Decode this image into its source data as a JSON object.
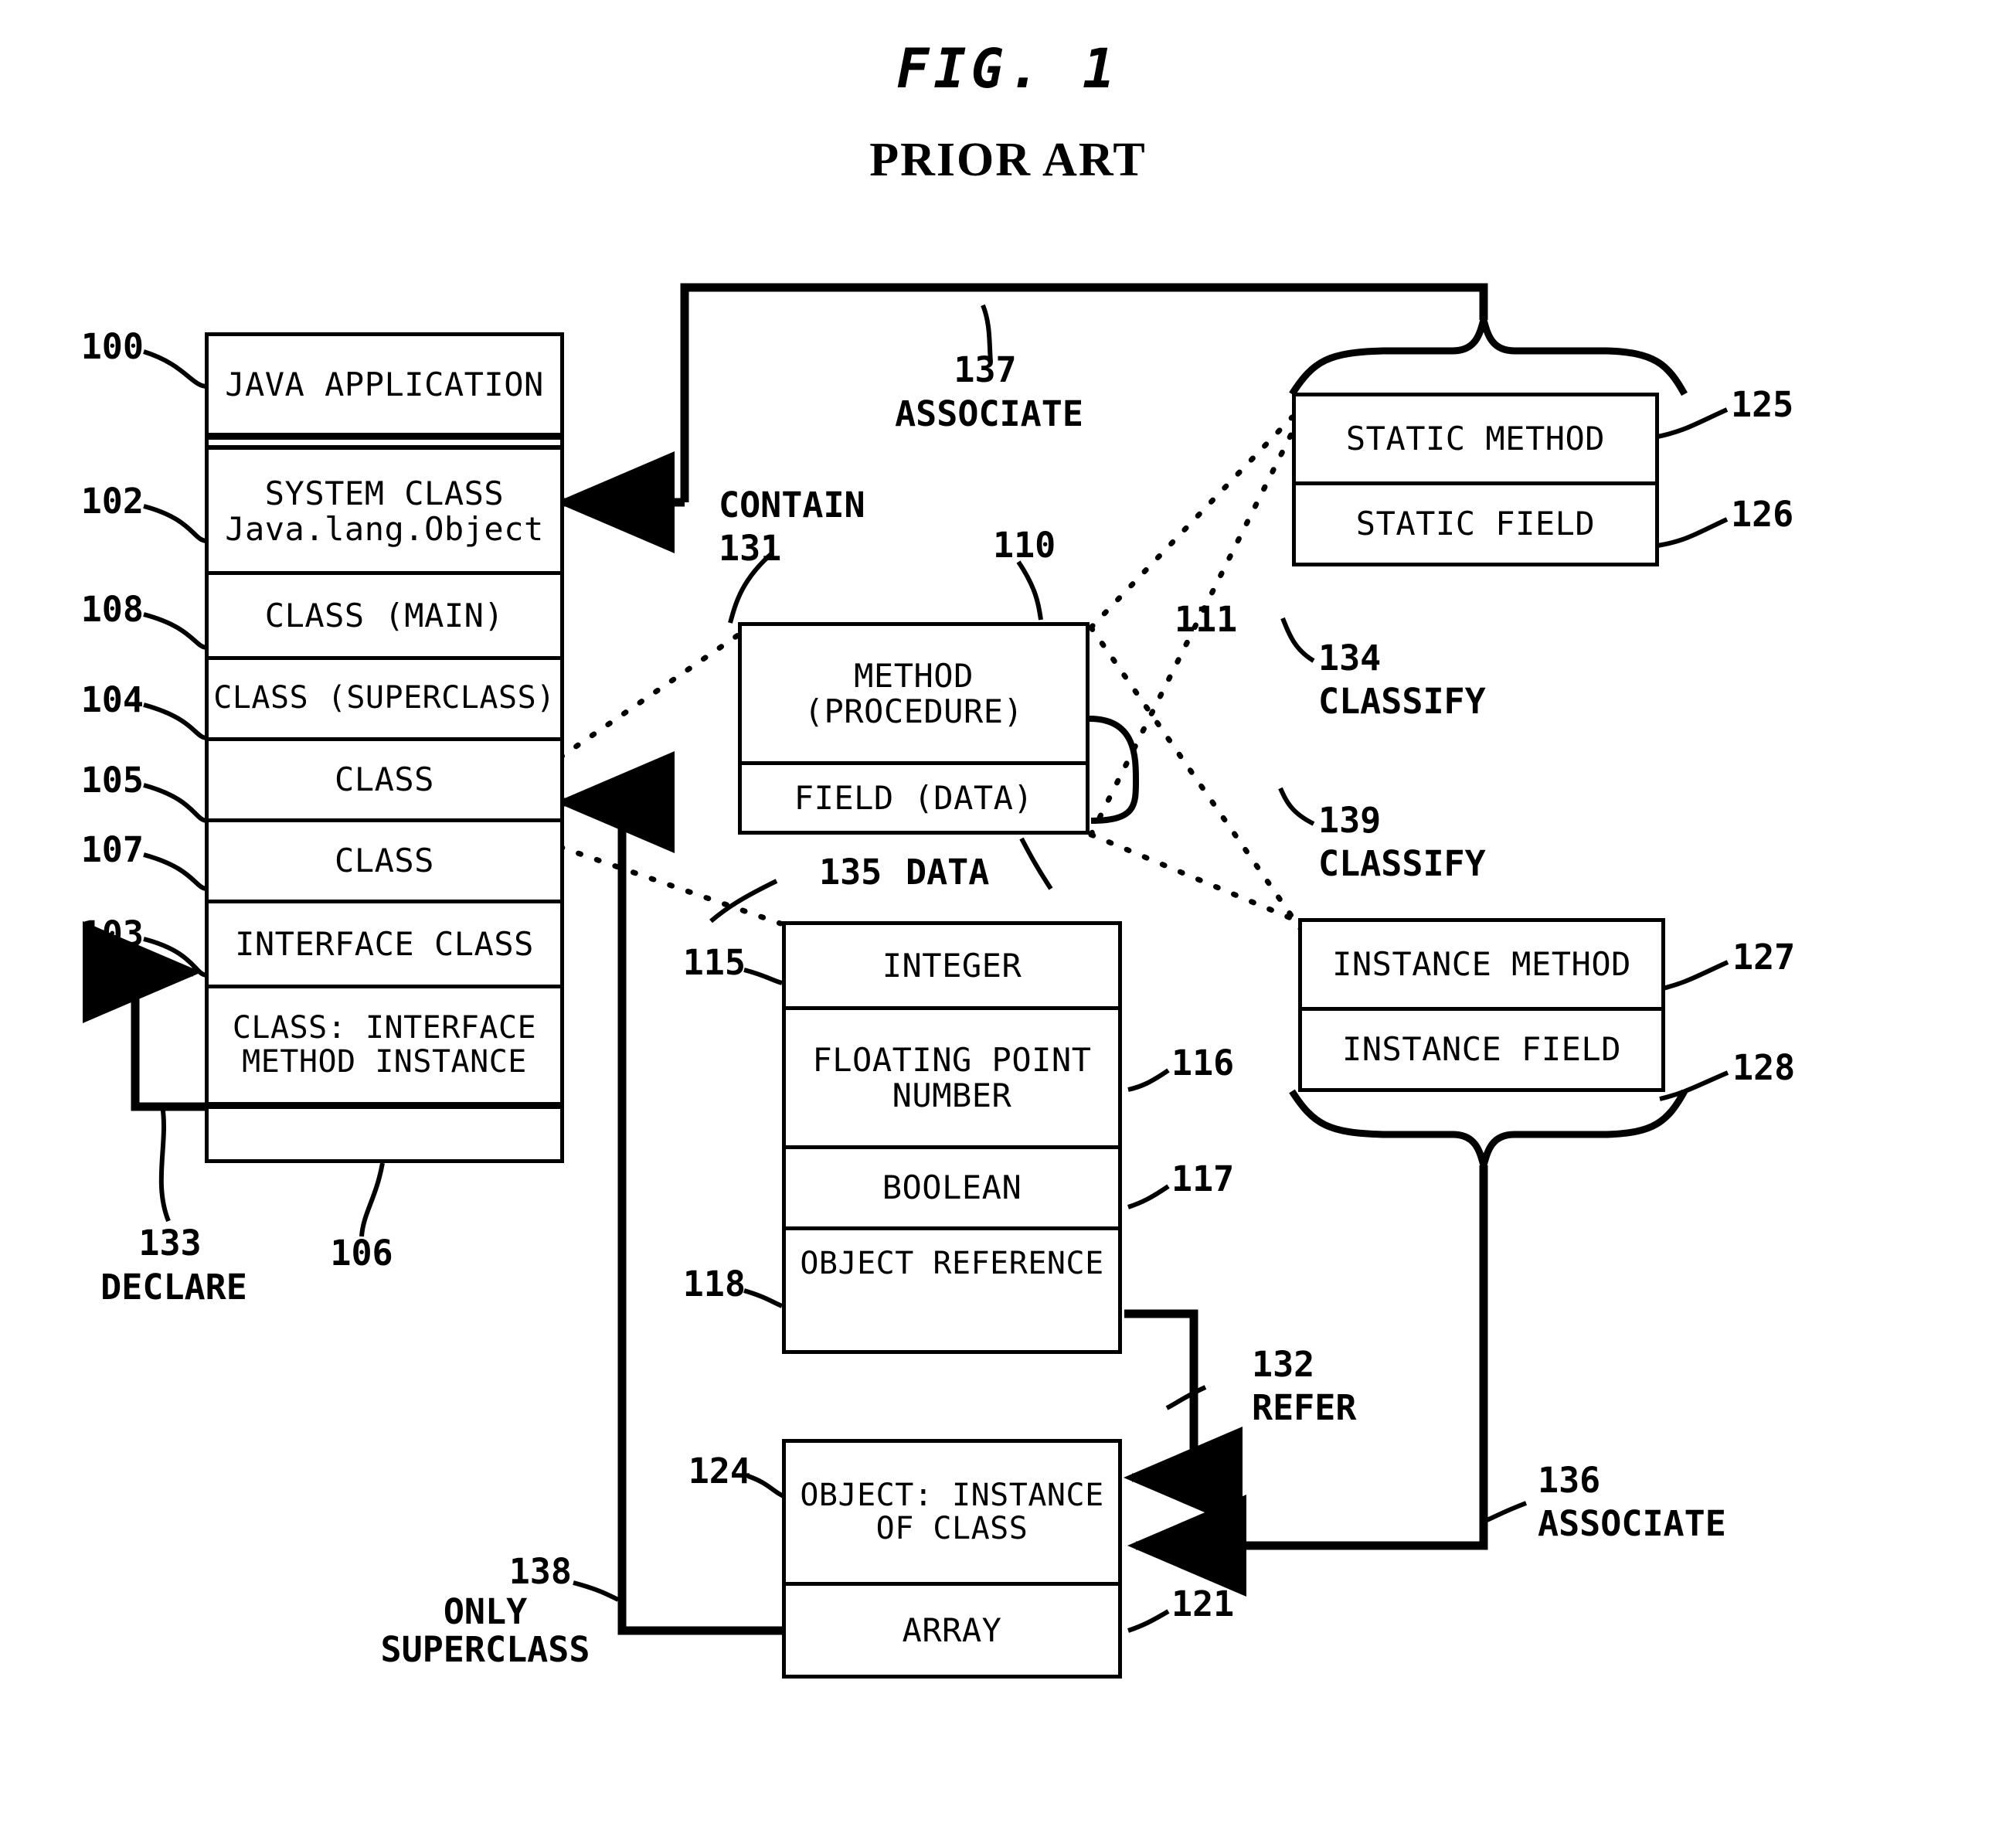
{
  "figure": {
    "title": "FIG. 1",
    "subtitle": "PRIOR ART"
  },
  "application_stack": {
    "label": "java-application-stack",
    "rows": [
      {
        "ref": "100",
        "text": "JAVA APPLICATION"
      },
      {
        "ref": "102",
        "text": "SYSTEM CLASS\nJava.lang.Object"
      },
      {
        "ref": "108",
        "text": "CLASS (MAIN)"
      },
      {
        "ref": "104",
        "text": "CLASS (SUPERCLASS)"
      },
      {
        "ref": "105",
        "text": "CLASS"
      },
      {
        "ref": "107",
        "text": "CLASS"
      },
      {
        "ref": "103",
        "text": "INTERFACE CLASS"
      },
      {
        "ref": "106",
        "text": "CLASS: INTERFACE\nMETHOD INSTANCE"
      }
    ]
  },
  "member_box": {
    "label": "class-member-box",
    "rows": [
      {
        "ref": "110",
        "text": "METHOD\n(PROCEDURE)"
      },
      {
        "ref": "111",
        "text": "FIELD (DATA)"
      }
    ]
  },
  "static_box": {
    "label": "static-members-box",
    "rows": [
      {
        "ref": "125",
        "text": "STATIC METHOD"
      },
      {
        "ref": "126",
        "text": "STATIC FIELD"
      }
    ]
  },
  "instance_box": {
    "label": "instance-members-box",
    "rows": [
      {
        "ref": "127",
        "text": "INSTANCE METHOD"
      },
      {
        "ref": "128",
        "text": "INSTANCE FIELD"
      }
    ]
  },
  "data_types_box": {
    "label": "data-types-box",
    "rows": [
      {
        "ref": "115",
        "text": "INTEGER"
      },
      {
        "ref": "116",
        "text": "FLOATING POINT\nNUMBER"
      },
      {
        "ref": "117",
        "text": "BOOLEAN"
      },
      {
        "ref": "118",
        "text": "OBJECT REFERENCE"
      }
    ]
  },
  "object_box": {
    "label": "object-instance-box",
    "rows": [
      {
        "ref": "124",
        "text": "OBJECT: INSTANCE\nOF CLASS"
      },
      {
        "ref": "121",
        "text": "ARRAY"
      }
    ]
  },
  "relations": {
    "associate_top": {
      "ref": "137",
      "text": "ASSOCIATE"
    },
    "contain": {
      "ref": "131",
      "text": "CONTAIN"
    },
    "classify_static": {
      "ref": "134",
      "text": "CLASSIFY"
    },
    "classify_instance": {
      "ref": "139",
      "text": "CLASSIFY"
    },
    "data": {
      "ref": "135",
      "text": "DATA"
    },
    "declare": {
      "ref": "133",
      "text": "DECLARE"
    },
    "refer": {
      "ref": "132",
      "text": "REFER"
    },
    "associate_bottom": {
      "ref": "136",
      "text": "ASSOCIATE"
    },
    "only_superclass": {
      "ref": "138",
      "text": "ONLY\nSUPERCLASS"
    }
  },
  "ref_numbers": {
    "n100": "100",
    "n102": "102",
    "n103": "103",
    "n104": "104",
    "n105": "105",
    "n106": "106",
    "n107": "107",
    "n108": "108",
    "n110": "110",
    "n111": "111",
    "n115": "115",
    "n116": "116",
    "n117": "117",
    "n118": "118",
    "n121": "121",
    "n124": "124",
    "n125": "125",
    "n126": "126",
    "n127": "127",
    "n128": "128",
    "n131": "131",
    "n132": "132",
    "n133": "133",
    "n134": "134",
    "n135": "135",
    "n136": "136",
    "n137": "137",
    "n138": "138",
    "n139": "139"
  },
  "colors": {
    "ink": "#000000",
    "paper": "#ffffff"
  }
}
